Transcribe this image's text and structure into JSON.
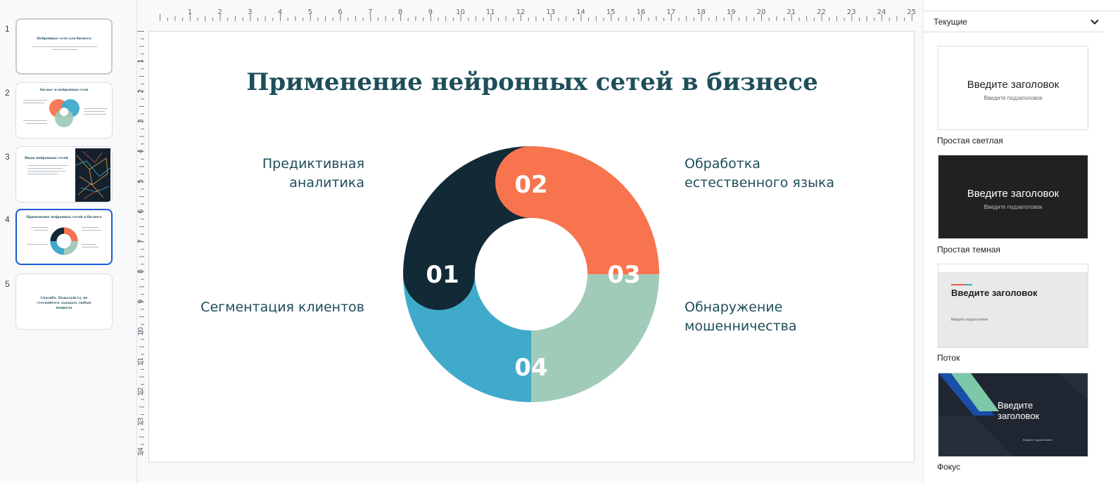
{
  "filmstrip": {
    "slides": [
      {
        "num": "1",
        "title": "Нейронные сети для бизнеса"
      },
      {
        "num": "2",
        "title": "Бизнес и нейронные сети"
      },
      {
        "num": "3",
        "title": "Виды нейронных сетей"
      },
      {
        "num": "4",
        "title": "Применение нейронных сетей в бизнесе"
      },
      {
        "num": "5",
        "title": "Спасибо. Пожалуйста, не стесняйтесь задавать любые вопросы"
      }
    ],
    "selected_index": 4
  },
  "ruler": {
    "h_labels": [
      "1",
      "2",
      "3",
      "4",
      "5",
      "6",
      "7",
      "8",
      "9",
      "10",
      "11",
      "12",
      "13",
      "14",
      "15",
      "16",
      "17",
      "18",
      "19",
      "20",
      "21",
      "22",
      "23",
      "24",
      "25"
    ],
    "v_labels": [
      "1",
      "2",
      "3",
      "4",
      "5",
      "6",
      "7",
      "8",
      "9",
      "10",
      "11",
      "12",
      "13",
      "14"
    ]
  },
  "slide": {
    "title": "Применение нейронных сетей в бизнесе",
    "labels": {
      "top_left": "Предиктивная\nаналитика",
      "top_right": "Обработка\nестественного языка",
      "bottom_left": "Сегментация клиентов",
      "bottom_right": "Обнаружение\nмошенничества"
    },
    "segments": [
      {
        "num": "01",
        "color": "#112a36"
      },
      {
        "num": "02",
        "color": "#f7744f"
      },
      {
        "num": "03",
        "color": "#a1cbb9"
      },
      {
        "num": "04",
        "color": "#40aacb"
      }
    ]
  },
  "themes_panel": {
    "dropdown_label": "Текущие",
    "themes": [
      {
        "name": "Простая светлая",
        "title": "Введите заголовок",
        "subtitle": "Введите подзаголовок",
        "bg": "#ffffff",
        "fg": "#202124"
      },
      {
        "name": "Простая темная",
        "title": "Введите заголовок",
        "subtitle": "Введите подзаголовок",
        "bg": "#212121",
        "fg": "#ffffff"
      },
      {
        "name": "Поток",
        "title": "Введите заголовок",
        "subtitle": "Введите подзаголовок",
        "bg": "#e8eaea",
        "fg": "#202124"
      },
      {
        "name": "Фокус",
        "title": "Введите\nзаголовок",
        "subtitle": "Введите подзаголовок",
        "bg": "#1f2631",
        "fg": "#ffffff"
      }
    ]
  }
}
